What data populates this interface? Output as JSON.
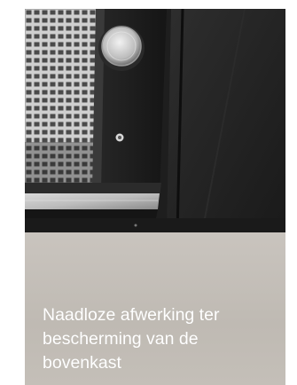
{
  "caption": "Naadloze afwerking ter bescherming van de bovenkast"
}
